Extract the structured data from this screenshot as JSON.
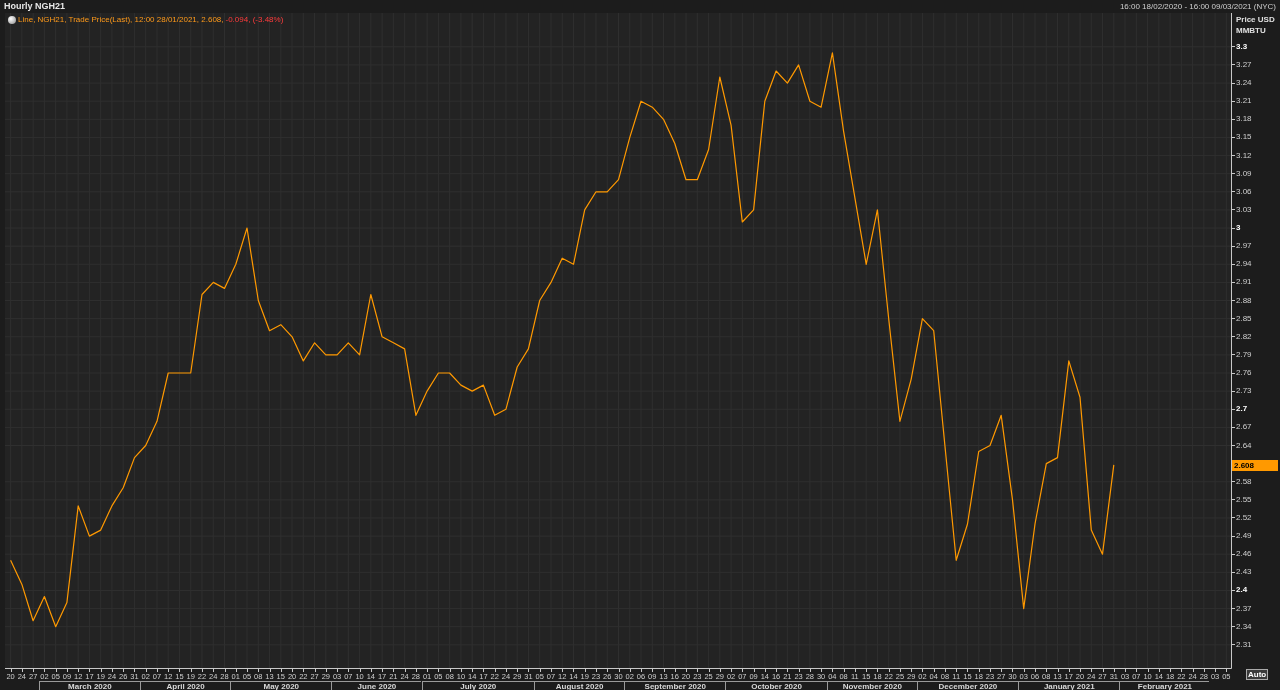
{
  "header": {
    "title": "Hourly NGH21",
    "range": "16:00 18/02/2020 - 16:00 09/03/2021 (NYC)"
  },
  "legend": {
    "prefix": "Line,",
    "rest": ", Trade Price(Last), 12:00 28/01/2021, 2.608,",
    "change": "-0.094, (-3.48%)"
  },
  "chart_data": {
    "type": "line",
    "grid": true,
    "ylabel": "Price USD MMBTU",
    "ylim": [
      2.27,
      3.356
    ],
    "categories": [
      "20",
      "24",
      "27",
      "02",
      "05",
      "09",
      "12",
      "17",
      "19",
      "24",
      "26",
      "31",
      "02",
      "07",
      "12",
      "15",
      "19",
      "22",
      "24",
      "28",
      "01",
      "05",
      "08",
      "13",
      "15",
      "20",
      "22",
      "27",
      "29",
      "03",
      "07",
      "10",
      "14",
      "17",
      "21",
      "24",
      "28",
      "01",
      "05",
      "08",
      "10",
      "14",
      "17",
      "22",
      "24",
      "29",
      "31",
      "05",
      "07",
      "12",
      "14",
      "19",
      "23",
      "26",
      "30",
      "02",
      "06",
      "09",
      "13",
      "16",
      "20",
      "23",
      "25",
      "29",
      "02",
      "07",
      "09",
      "14",
      "16",
      "21",
      "23",
      "28",
      "30",
      "04",
      "08",
      "11",
      "15",
      "18",
      "22",
      "25",
      "29",
      "02",
      "04",
      "08",
      "11",
      "15",
      "18",
      "23",
      "27",
      "30",
      "03",
      "06",
      "08",
      "13",
      "17",
      "20",
      "24",
      "27",
      "31",
      "03",
      "07",
      "10",
      "14",
      "18",
      "22",
      "24",
      "28",
      "03",
      "05"
    ],
    "series": [
      {
        "name": "NGH21",
        "color": "#ff9900",
        "values": [
          2.45,
          2.41,
          2.35,
          2.39,
          2.34,
          2.38,
          2.54,
          2.49,
          2.5,
          2.54,
          2.57,
          2.62,
          2.64,
          2.68,
          2.76,
          2.76,
          2.76,
          2.89,
          2.91,
          2.9,
          2.94,
          3.0,
          2.88,
          2.83,
          2.84,
          2.82,
          2.78,
          2.81,
          2.79,
          2.79,
          2.81,
          2.79,
          2.89,
          2.82,
          2.81,
          2.8,
          2.69,
          2.73,
          2.76,
          2.76,
          2.74,
          2.73,
          2.74,
          2.69,
          2.7,
          2.77,
          2.8,
          2.88,
          2.91,
          2.95,
          2.94,
          3.03,
          3.06,
          3.06,
          3.08,
          3.15,
          3.21,
          3.2,
          3.18,
          3.14,
          3.08,
          3.08,
          3.13,
          3.25,
          3.17,
          3.01,
          3.03,
          3.21,
          3.26,
          3.24,
          3.27,
          3.21,
          3.2,
          3.29,
          3.16,
          3.05,
          2.94,
          3.03,
          2.85,
          2.68,
          2.75,
          2.85,
          2.83,
          2.64,
          2.45,
          2.51,
          2.63,
          2.64,
          2.69,
          2.55,
          2.37,
          2.51,
          2.61,
          2.62,
          2.78,
          2.72,
          2.5,
          2.46,
          2.608,
          null,
          null,
          null,
          null,
          null,
          null,
          null,
          null,
          null,
          null
        ]
      }
    ],
    "yticks": [
      3.3,
      3.27,
      3.24,
      3.21,
      3.18,
      3.15,
      3.12,
      3.09,
      3.06,
      3.03,
      3,
      2.97,
      2.94,
      2.91,
      2.88,
      2.85,
      2.82,
      2.79,
      2.76,
      2.73,
      2.7,
      2.67,
      2.64,
      2.58,
      2.55,
      2.52,
      2.49,
      2.46,
      2.43,
      2.4,
      2.37,
      2.34,
      2.31
    ],
    "annotations": [
      "2.608"
    ]
  },
  "month_axis": [
    "March 2020",
    "April 2020",
    "May 2020",
    "June 2020",
    "July 2020",
    "August 2020",
    "September 2020",
    "October 2020",
    "November 2020",
    "December 2020",
    "January 2021",
    "February 2021"
  ],
  "auto_button": "Auto"
}
